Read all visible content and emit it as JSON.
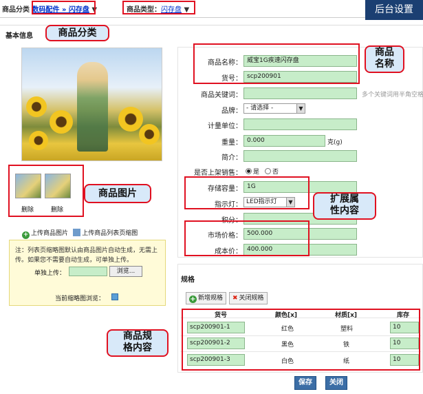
{
  "header": {
    "category_label": "商品分类",
    "category_value": "数码配件 » 闪存盘",
    "type_label": "商品类型：",
    "type_value": "闪存盘",
    "admin_button": "后台设置"
  },
  "section": {
    "basic_info": "基本信息"
  },
  "callouts": {
    "category": "商品分类",
    "name": "商品\n名称",
    "images": "商品图片",
    "ext_attrs": "扩展属\n性内容",
    "spec": "商品规\n格内容"
  },
  "images": {
    "delete_label_1": "删除",
    "delete_label_2": "删除",
    "upload_image": "上传商品图片",
    "upload_list_thumb": "上传商品列表页缩图",
    "note": "注：列表页缩略图默认由商品图片自动生成，无需上传。如果您不需要自动生成，可单独上传。",
    "upload_label": "单独上传：",
    "browse_button": "浏览...",
    "preview_label": "当前缩略图浏览："
  },
  "form": {
    "name_label": "商品名称：",
    "name_value": "威宝1G疾速闪存盘",
    "sku_label": "货号：",
    "sku_value": "scp200901",
    "keywords_label": "商品关键词：",
    "keywords_hint": "多个关键词用半角空格",
    "brand_label": "品牌：",
    "brand_value": "- 请选择 -",
    "unit_label": "计量单位：",
    "weight_label": "重量：",
    "weight_value": "0.000",
    "weight_unit": "克(g)",
    "intro_label": "简介：",
    "onsale_label": "是否上架销售：",
    "onsale_yes": "是",
    "onsale_no": "否",
    "capacity_label": "存储容量：",
    "capacity_value": "1G",
    "indicator_label": "指示灯：",
    "indicator_value": "LED指示灯",
    "points_label": "积分：",
    "market_price_label": "市场价格：",
    "market_price_value": "500.000",
    "cost_label": "成本价：",
    "cost_value": "400.000"
  },
  "spec": {
    "title": "规格",
    "add_button": "新增规格",
    "close_button": "关闭规格",
    "headers": [
      "货号",
      "颜色[x]",
      "材质[x]",
      "库存"
    ],
    "rows": [
      {
        "sku": "scp200901-1",
        "color": "红色",
        "material": "塑料",
        "stock": "10"
      },
      {
        "sku": "scp200901-2",
        "color": "黑色",
        "material": "铁",
        "stock": "10"
      },
      {
        "sku": "scp200901-3",
        "color": "白色",
        "material": "纸",
        "stock": "10"
      }
    ]
  },
  "footer": {
    "save": "保存",
    "close": "关闭"
  },
  "colors": {
    "highlight_red": "#e01020",
    "callout_bg": "#d8e9f9",
    "input_green": "#c7edc9",
    "admin_bg": "#1b3f72"
  }
}
